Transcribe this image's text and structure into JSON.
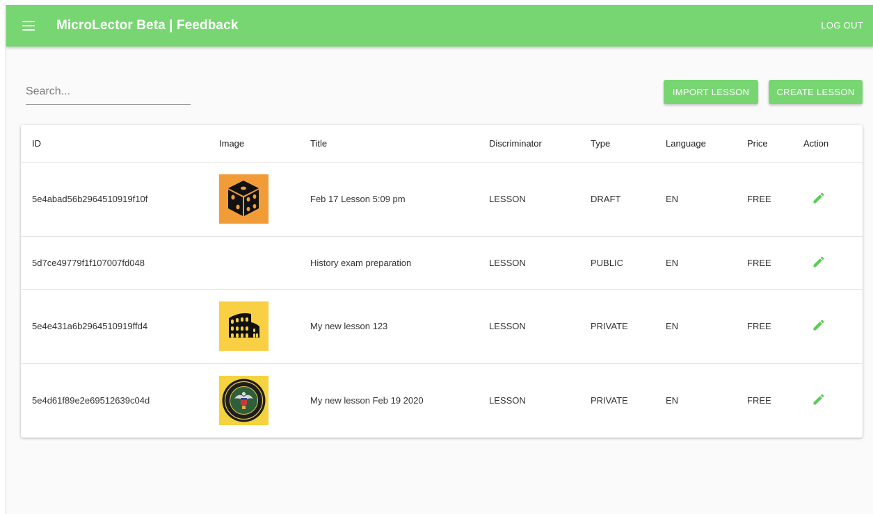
{
  "appbar": {
    "title": "MicroLector Beta | Feedback",
    "logout_label": "LOG OUT"
  },
  "toolbar": {
    "search_placeholder": "Search...",
    "import_label": "IMPORT LESSON",
    "create_label": "CREATE LESSON"
  },
  "table": {
    "headers": {
      "id": "ID",
      "image": "Image",
      "title": "Title",
      "discriminator": "Discriminator",
      "type": "Type",
      "language": "Language",
      "price": "Price",
      "action": "Action"
    },
    "rows": [
      {
        "id": "5e4abad56b2964510919f10f",
        "image": "dice-icon",
        "title": "Feb 17 Lesson 5:09 pm",
        "discriminator": "LESSON",
        "type": "DRAFT",
        "language": "EN",
        "price": "FREE"
      },
      {
        "id": "5d7ce49779f1f107007fd048",
        "image": "",
        "title": "History exam preparation",
        "discriminator": "LESSON",
        "type": "PUBLIC",
        "language": "EN",
        "price": "FREE"
      },
      {
        "id": "5e4e431a6b2964510919ffd4",
        "image": "colosseum-icon",
        "title": "My new lesson 123",
        "discriminator": "LESSON",
        "type": "PRIVATE",
        "language": "EN",
        "price": "FREE"
      },
      {
        "id": "5e4d61f89e2e69512639c04d",
        "image": "army-seal-icon",
        "title": "My new lesson Feb 19 2020",
        "discriminator": "LESSON",
        "type": "PRIVATE",
        "language": "EN",
        "price": "FREE"
      }
    ]
  },
  "colors": {
    "accent": "#78d672",
    "dice_bg": "#f29c38",
    "colosseum_bg": "#f9cf44",
    "army_bg": "#f4d33f"
  }
}
